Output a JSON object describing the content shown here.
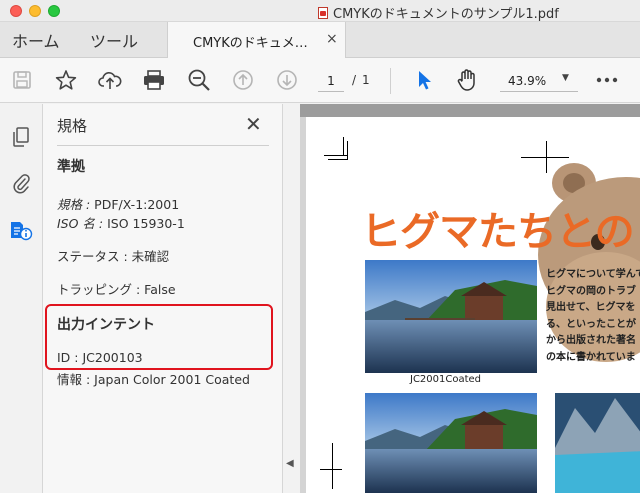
{
  "window": {
    "title": "CMYKのドキュメントのサンプル1.pdf"
  },
  "tabs": {
    "home_label": "ホーム",
    "tools_label": "ツール",
    "document_tab_label": "CMYKのドキュメ…",
    "close_glyph": "×"
  },
  "toolbar": {
    "current_page": "1",
    "page_separator": "/",
    "total_pages": "1",
    "zoom": "43.9%",
    "zoom_caret": "▼",
    "icons": [
      "save-icon",
      "bookmark-star-icon",
      "upload-cloud-icon",
      "print-icon",
      "zoom-out-icon",
      "previous-page-icon",
      "next-page-icon",
      "select-pointer-icon",
      "hand-tool-icon",
      "more-options-icon"
    ]
  },
  "rail": {
    "icons": [
      "page-thumbnails-icon",
      "attachments-icon",
      "standards-info-icon"
    ]
  },
  "panel": {
    "title": "規格",
    "close_glyph": "✕",
    "compliance_heading": "準拠",
    "standard_key": "規格 :",
    "standard_value": "PDF/X-1:2001",
    "iso_key": "ISO 名 :",
    "iso_value": "ISO 15930-1",
    "status_text": "ステータス : 未確認",
    "trapping_text": "トラッピング : False",
    "output_intent_heading": "出力インテント",
    "id_text": "ID : JC200103",
    "info_text": "情報 : Japan Color 2001 Coated",
    "collapse_glyph": "◀"
  },
  "document": {
    "headline": "ヒグマたちとの",
    "photo_caption": "JC2001Coated",
    "body_lines": [
      "ヒグマについて学んで",
      "ヒグマの岡のトラブ",
      "見出せて、ヒグマを",
      "る、といったことが",
      "から出版された著名",
      "の本に書かれていま"
    ]
  },
  "colors": {
    "accent_red": "#e0141e",
    "headline_orange": "#ea6a26",
    "pointer_blue": "#1473e6"
  }
}
